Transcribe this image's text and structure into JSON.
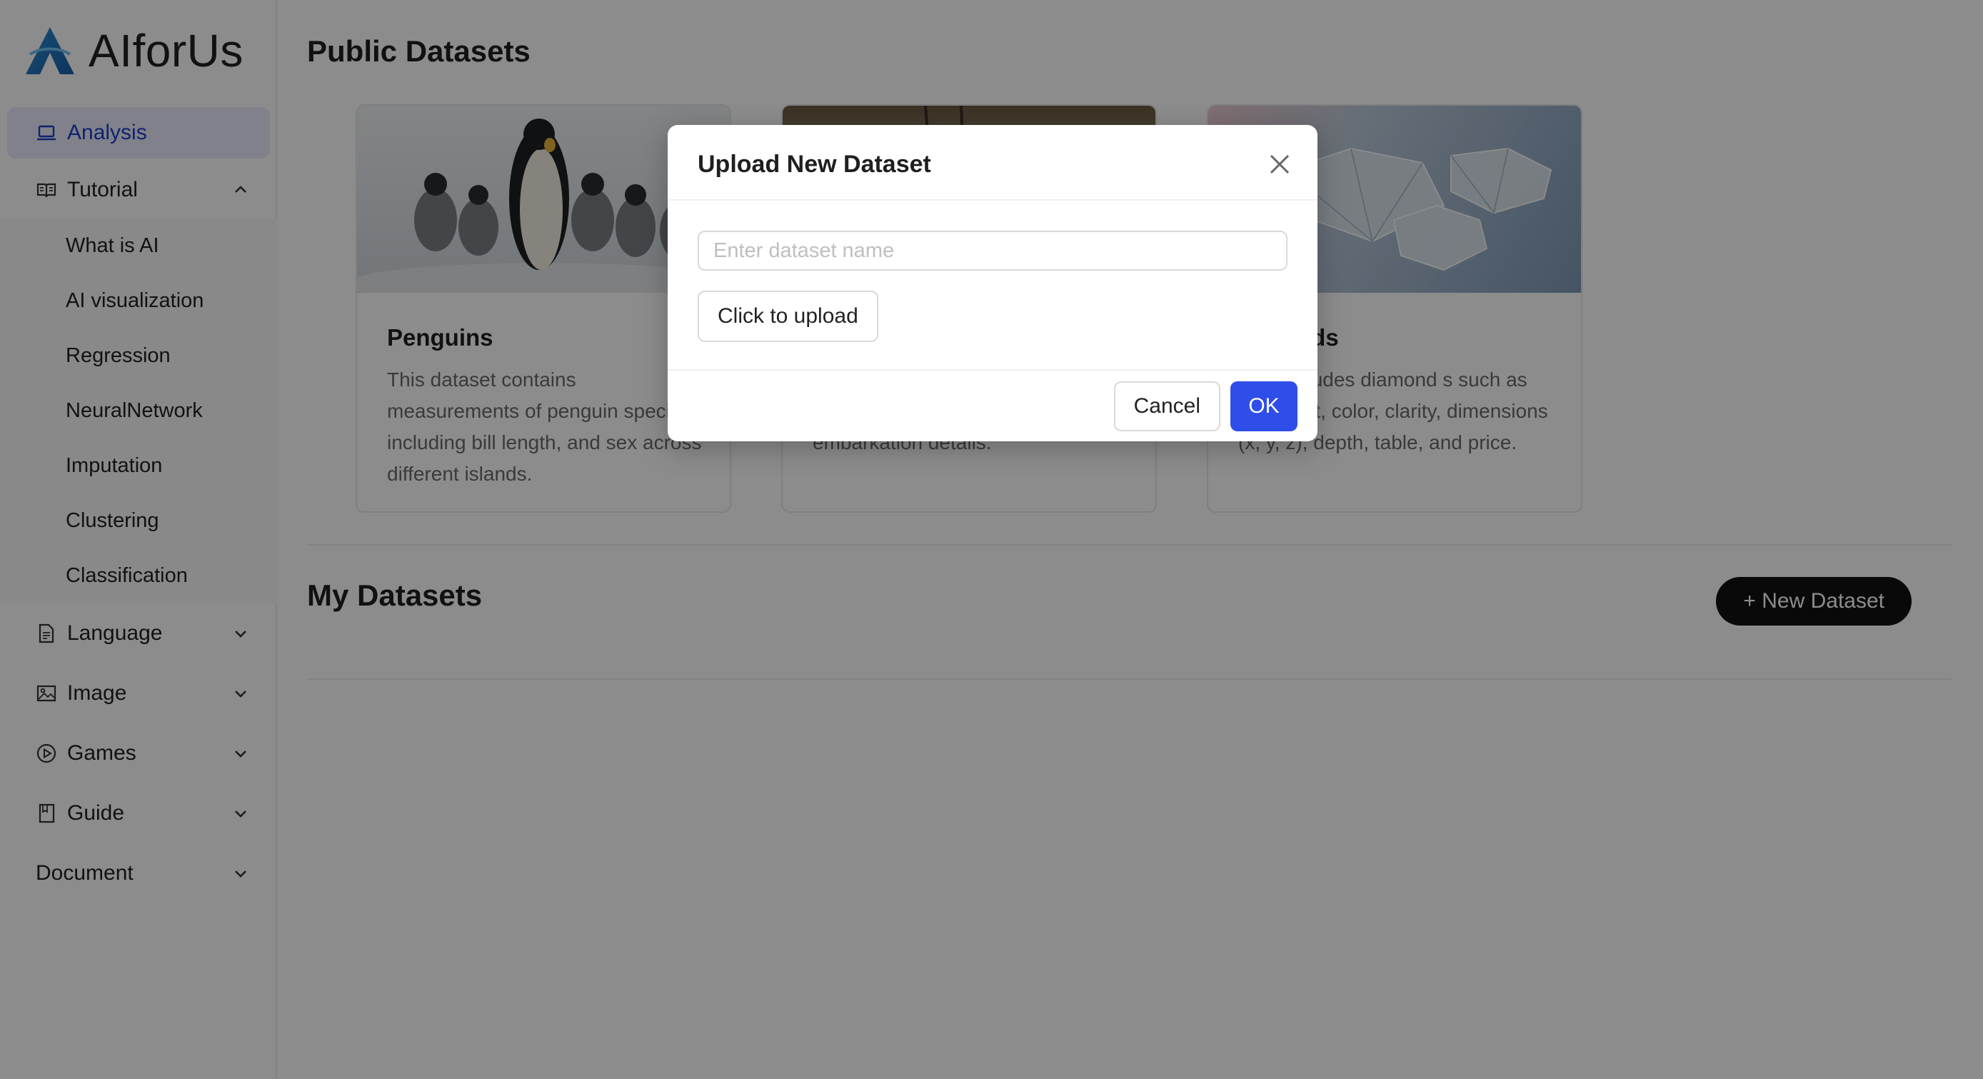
{
  "app": {
    "name": "AIforUs"
  },
  "sidebar": {
    "items": [
      {
        "label": "Analysis",
        "icon": "laptop-icon",
        "active": true
      },
      {
        "label": "Tutorial",
        "icon": "book-open-icon",
        "expanded": true,
        "children": [
          "What is AI",
          "AI visualization",
          "Regression",
          "NeuralNetwork",
          "Imputation",
          "Clustering",
          "Classification"
        ]
      },
      {
        "label": "Language",
        "icon": "file-text-icon",
        "expanded": false
      },
      {
        "label": "Image",
        "icon": "image-icon",
        "expanded": false
      },
      {
        "label": "Games",
        "icon": "play-circle-icon",
        "expanded": false
      },
      {
        "label": "Guide",
        "icon": "bookmark-book-icon",
        "expanded": false
      },
      {
        "label": "Document",
        "icon": "",
        "expanded": false
      }
    ]
  },
  "main": {
    "public_title": "Public Datasets",
    "cards": [
      {
        "title": "Penguins",
        "desc": "This dataset contains measurements of penguin species, including bill length, and sex across different islands."
      },
      {
        "title": "",
        "desc": "survival status, class, age, fare, and embarkation details."
      },
      {
        "title": "nds",
        "desc": "aset includes diamond s such as carat, cut, color, clarity, dimensions (x, y, z), depth, table, and price."
      }
    ],
    "my_title": "My Datasets",
    "new_button": "+ New Dataset"
  },
  "modal": {
    "title": "Upload New Dataset",
    "name_placeholder": "Enter dataset name",
    "name_value": "",
    "upload_label": "Click to upload",
    "cancel_label": "Cancel",
    "ok_label": "OK"
  },
  "colors": {
    "accent": "#2f4de8",
    "active_bg": "#e9ecfb",
    "active_text": "#1e3cc8"
  }
}
